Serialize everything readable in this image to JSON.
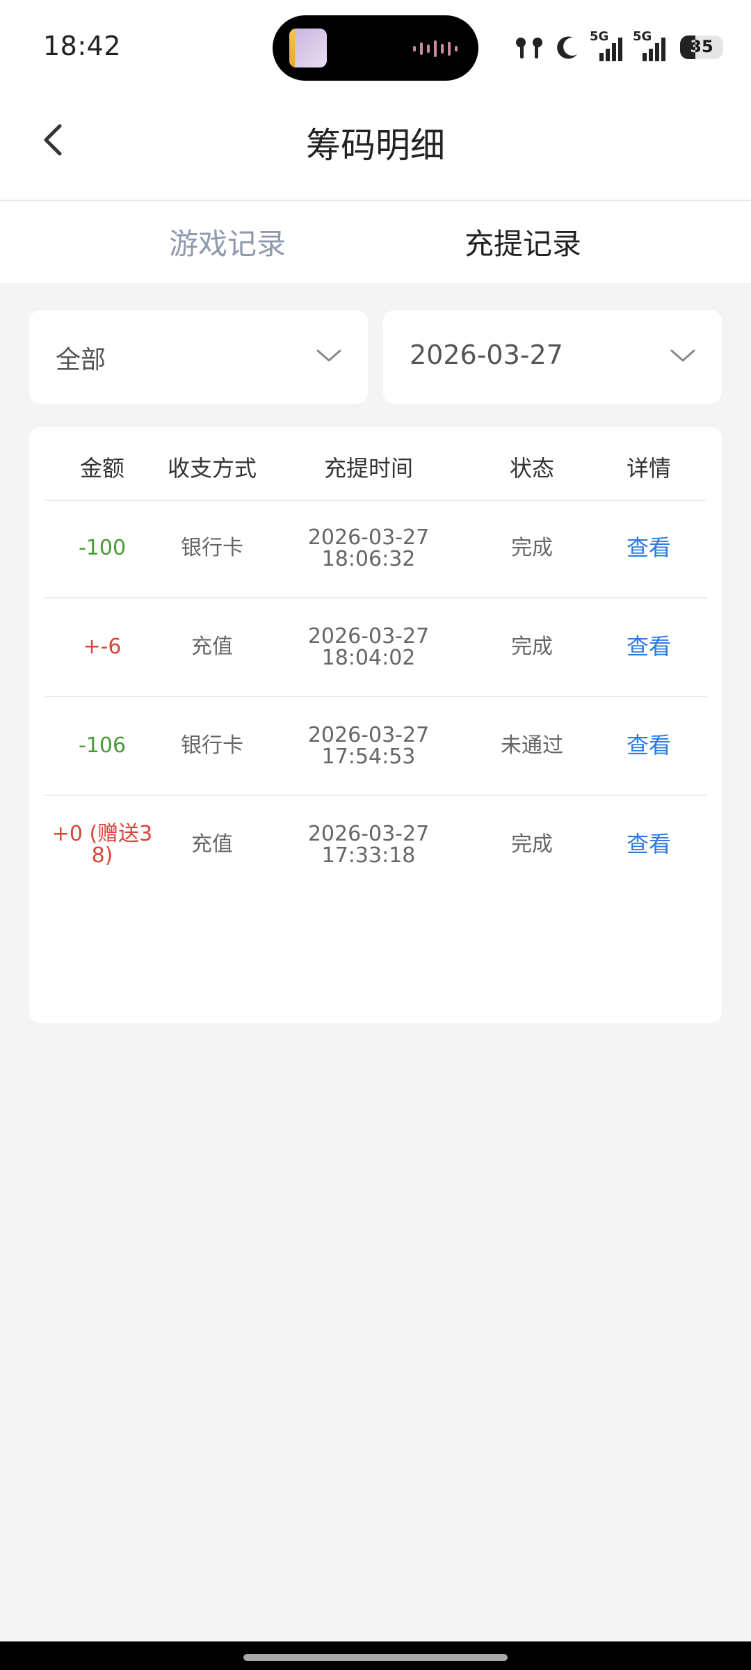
{
  "status_bar": {
    "time": "18:42",
    "network1": "5G",
    "network2": "5G",
    "battery": "35",
    "icons": [
      "earbuds-icon",
      "moon-icon",
      "signal-icon",
      "signal-icon",
      "battery-icon"
    ]
  },
  "header": {
    "title": "筹码明细",
    "back_icon": "chevron-left-icon"
  },
  "tabs": [
    {
      "label": "游戏记录",
      "active": false
    },
    {
      "label": "充提记录",
      "active": true
    }
  ],
  "filters": {
    "type": {
      "value": "全部",
      "icon": "chevron-down-icon"
    },
    "date": {
      "value": "2026-03-27",
      "icon": "chevron-down-icon"
    }
  },
  "table": {
    "columns": [
      "金额",
      "收支方式",
      "充提时间",
      "状态",
      "详情"
    ],
    "rows": [
      {
        "amount": "-100",
        "method": "银行卡",
        "date": "2026-03-27",
        "time": "18:06:32",
        "status": "完成",
        "detail": "查看",
        "kind": "neg"
      },
      {
        "amount": "+-6",
        "method": "充值",
        "date": "2026-03-27",
        "time": "18:04:02",
        "status": "完成",
        "detail": "查看",
        "kind": "pos"
      },
      {
        "amount": "-106",
        "method": "银行卡",
        "date": "2026-03-27",
        "time": "17:54:53",
        "status": "未通过",
        "detail": "查看",
        "kind": "neg"
      },
      {
        "amount": "+0 (赠送38)",
        "method": "充值",
        "date": "2026-03-27",
        "time": "17:33:18",
        "status": "完成",
        "detail": "查看",
        "kind": "pos"
      }
    ]
  },
  "colors": {
    "negative": "#4b9a38",
    "positive": "#d9463a",
    "link": "#2d7be0",
    "inactive_tab": "#8f9aae",
    "background": "#f4f4f4"
  }
}
